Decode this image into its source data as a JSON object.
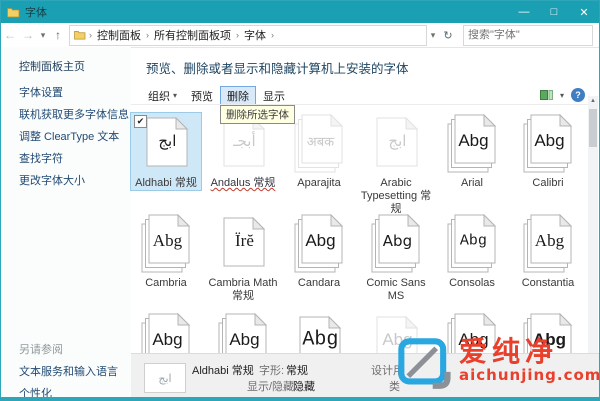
{
  "window": {
    "title": "字体",
    "minimize_glyph": "—",
    "maximize_glyph": "□",
    "close_glyph": "✕"
  },
  "addressbar": {
    "back_glyph": "←",
    "forward_glyph": "→",
    "recent_glyph": "▾",
    "up_glyph": "↑",
    "crumbs": [
      "控制面板",
      "所有控制面板项",
      "字体"
    ],
    "separator": "›",
    "address_dropdown_glyph": "▾",
    "refresh_glyph": "↻",
    "search_placeholder": "搜索\"字体\""
  },
  "sidebar": {
    "home": "控制面板主页",
    "tasks": [
      "字体设置",
      "联机获取更多字体信息",
      "调整 ClearType 文本",
      "查找字符",
      "更改字体大小"
    ],
    "see_also": "另请参阅",
    "see_also_items": [
      "文本服务和输入语言",
      "个性化"
    ]
  },
  "main": {
    "header": "预览、删除或者显示和隐藏计算机上安装的字体",
    "toolbar": {
      "organize": "组织",
      "organize_caret": "▾",
      "preview": "预览",
      "delete": "删除",
      "show": "显示",
      "views_caret": "▾",
      "help_glyph": "?"
    },
    "tooltip": "删除所选字体"
  },
  "fonts": {
    "check_glyph": "✔",
    "rows": [
      [
        {
          "label": "Aldhabi 常规",
          "preview": "ابج",
          "font": "arabic",
          "stack": 1,
          "selected": true,
          "checked": true
        },
        {
          "label": "Andalus 常规",
          "preview": "أبجـ",
          "font": "arabic",
          "stack": 1,
          "hidden": true,
          "labelClass": "scribble"
        },
        {
          "label": "Aparajita",
          "preview": "अबक",
          "font": "deva",
          "stack": 3,
          "hidden": true
        },
        {
          "label": "Arabic Typesetting 常规",
          "preview": "ابج",
          "font": "arabic",
          "stack": 1,
          "hidden": true
        },
        {
          "label": "Arial",
          "preview": "Abg",
          "font": "sans",
          "stack": 3
        },
        {
          "label": "Calibri",
          "preview": "Abg",
          "font": "sans",
          "stack": 3
        }
      ],
      [
        {
          "label": "Cambria",
          "preview": "Abg",
          "font": "serif",
          "stack": 3
        },
        {
          "label": "Cambria Math 常规",
          "preview": "Ïrĕ",
          "font": "math",
          "stack": 1
        },
        {
          "label": "Candara",
          "preview": "Abg",
          "font": "sans",
          "stack": 3
        },
        {
          "label": "Comic Sans MS",
          "preview": "Abg",
          "font": "comic",
          "stack": 3
        },
        {
          "label": "Consolas",
          "preview": "Abg",
          "font": "mono",
          "stack": 3
        },
        {
          "label": "Constantia",
          "preview": "Abg",
          "font": "serif",
          "stack": 3
        }
      ],
      [
        {
          "label": "",
          "preview": "Abg",
          "font": "sans",
          "stack": 3
        },
        {
          "label": "",
          "preview": "Abg",
          "font": "sans",
          "stack": 3
        },
        {
          "label": "",
          "preview": "Abg",
          "font": "mono-lg",
          "stack": 1
        },
        {
          "label": "",
          "preview": "Abg",
          "font": "sans",
          "stack": 1,
          "hidden": true
        },
        {
          "label": "",
          "preview": "Abg",
          "font": "sans",
          "stack": 3
        },
        {
          "label": "",
          "preview": "Abg",
          "font": "bold",
          "stack": 3
        }
      ]
    ]
  },
  "statusbar": {
    "preview_glyph": "ابج",
    "font_name": "Aldhabi 常规",
    "style_label": "字形:",
    "style_value": "常规",
    "visibility_label": "显示/隐藏:",
    "visibility_value": "隐藏",
    "designed_fragment": "设计用",
    "category_fragment": "类"
  },
  "watermark": {
    "brand": "爱纯净",
    "url": "aichunjing.com"
  }
}
